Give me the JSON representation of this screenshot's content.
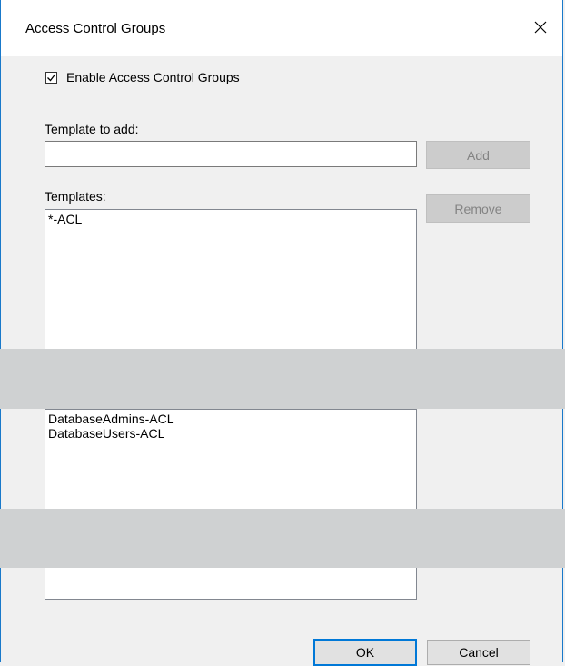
{
  "dialog": {
    "title": "Access Control Groups",
    "close_icon": "close-icon"
  },
  "enable": {
    "label": "Enable Access Control Groups",
    "checked": true
  },
  "template_input": {
    "label": "Template to add:",
    "value": "",
    "placeholder": ""
  },
  "buttons": {
    "add": "Add",
    "remove": "Remove",
    "ok": "OK",
    "cancel": "Cancel"
  },
  "templates": {
    "label": "Templates:",
    "items": [
      "*-ACL"
    ]
  },
  "groups": {
    "items": [
      "DatabaseAdmins-ACL",
      "DatabaseUsers-ACL"
    ]
  },
  "colors": {
    "accent": "#0078d7",
    "redaction": "#cfd1d2"
  }
}
